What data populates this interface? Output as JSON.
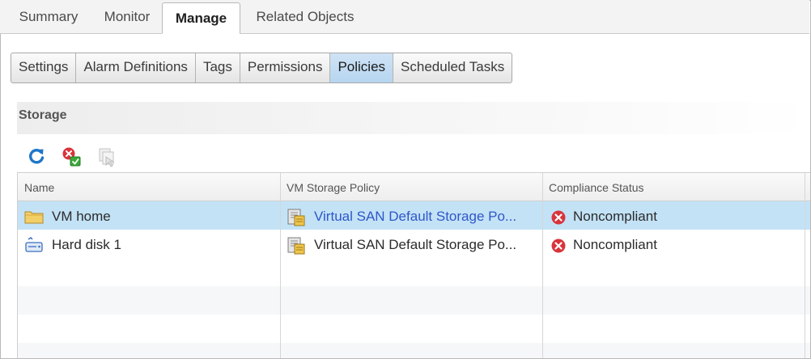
{
  "top_tabs": [
    {
      "label": "Summary",
      "active": false
    },
    {
      "label": "Monitor",
      "active": false
    },
    {
      "label": "Manage",
      "active": true
    },
    {
      "label": "Related Objects",
      "active": false
    }
  ],
  "sub_tabs": [
    {
      "label": "Settings",
      "active": false
    },
    {
      "label": "Alarm Definitions",
      "active": false
    },
    {
      "label": "Tags",
      "active": false
    },
    {
      "label": "Permissions",
      "active": false
    },
    {
      "label": "Policies",
      "active": true
    },
    {
      "label": "Scheduled Tasks",
      "active": false
    }
  ],
  "section": {
    "title": "Storage"
  },
  "toolbar": {
    "icons": [
      "refresh-icon",
      "check-compliance-icon",
      "reapply-policy-icon"
    ]
  },
  "table": {
    "columns": [
      "Name",
      "VM Storage Policy",
      "Compliance Status"
    ],
    "rows": [
      {
        "name": "VM home",
        "name_icon": "folder-icon",
        "policy": "Virtual SAN Default Storage Po...",
        "policy_icon": "storage-policy-icon",
        "status": "Noncompliant",
        "status_icon": "error-icon",
        "selected": true
      },
      {
        "name": "Hard disk 1",
        "name_icon": "hard-disk-icon",
        "policy": "Virtual SAN Default Storage Po...",
        "policy_icon": "storage-policy-icon",
        "status": "Noncompliant",
        "status_icon": "error-icon",
        "selected": false
      }
    ]
  },
  "colors": {
    "selected_row": "#c3e2f6",
    "active_subtab": "#b6d5f0",
    "link": "#2f57c9",
    "error": "#d9343b",
    "refresh": "#1f76c8"
  }
}
